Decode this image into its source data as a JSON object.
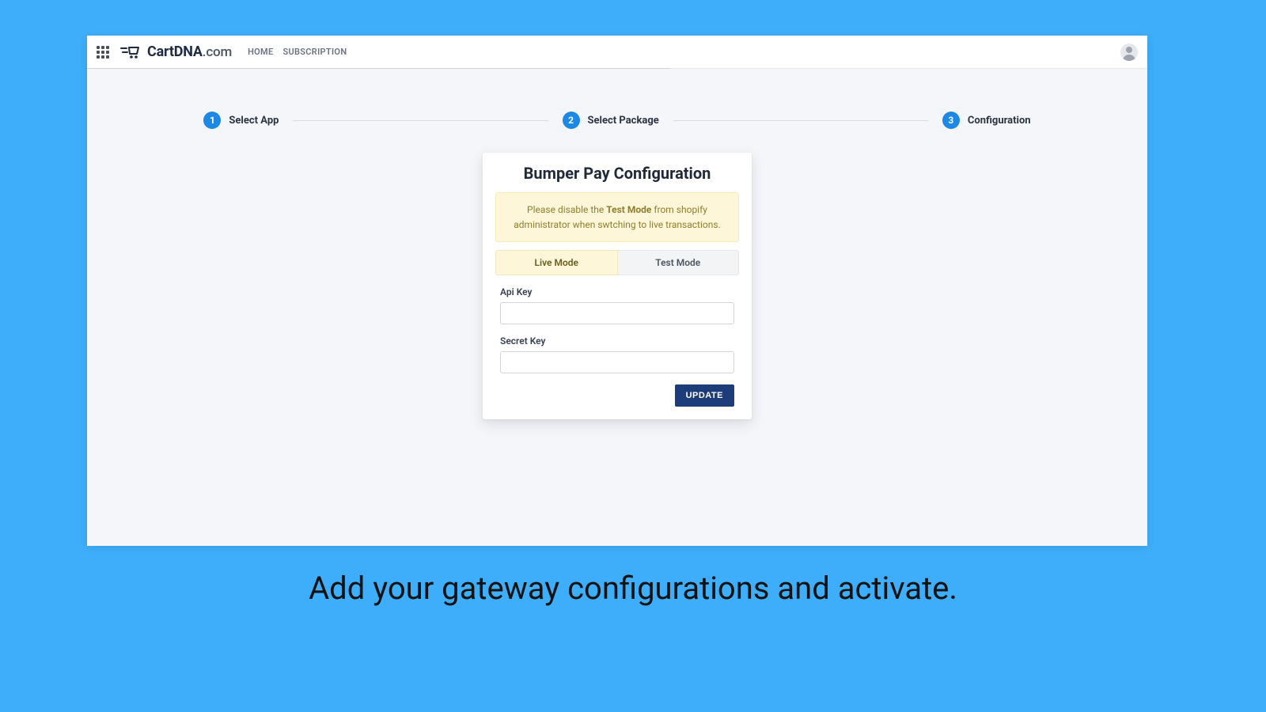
{
  "brand": {
    "name": "CartDNA",
    "suffix": ".com"
  },
  "nav": {
    "home": "HOME",
    "subscription": "SUBSCRIPTION"
  },
  "stepper": {
    "steps": [
      {
        "num": "1",
        "label": "Select App"
      },
      {
        "num": "2",
        "label": "Select Package"
      },
      {
        "num": "3",
        "label": "Configuration"
      }
    ]
  },
  "card": {
    "title": "Bumper Pay Configuration",
    "alert_pre": "Please disable the ",
    "alert_bold": "Test Mode",
    "alert_post": " from shopify administrator when swtching to live transactions.",
    "tabs": {
      "live": "Live Mode",
      "test": "Test Mode"
    },
    "fields": {
      "api_key": {
        "label": "Api Key",
        "value": ""
      },
      "secret_key": {
        "label": "Secret Key",
        "value": ""
      }
    },
    "update_button": "UPDATE"
  },
  "caption": "Add your gateway configurations and activate."
}
